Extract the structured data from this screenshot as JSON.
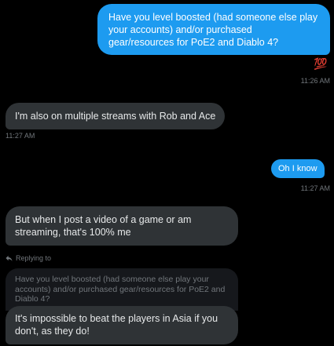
{
  "messages": {
    "m1": {
      "text": "Have you level boosted (had someone else play your accounts) and/or purchased gear/resources for PoE2 and Diablo 4?",
      "reaction": "💯",
      "time": "11:26 AM"
    },
    "m2": {
      "text": "I'm also on multiple streams with Rob and Ace",
      "time": "11:27 AM"
    },
    "m3": {
      "text": "Oh I know",
      "time": "11:27 AM"
    },
    "m4": {
      "text": "But when I post a video of a game or am streaming, that's 100% me"
    },
    "reply": {
      "header": "Replying to",
      "quoted": "Have you level boosted (had someone else play your accounts) and/or purchased gear/resources for PoE2 and Diablo 4?",
      "text": "It's impossible to beat the players in Asia if you don't, as they do!"
    }
  },
  "colors": {
    "sent": "#1d9bf0",
    "received": "#2f3336",
    "background": "#000000",
    "timestamp": "#71767b"
  },
  "icons": {
    "reply": "reply-arrow-icon",
    "reaction": "hundred-points-emoji"
  }
}
